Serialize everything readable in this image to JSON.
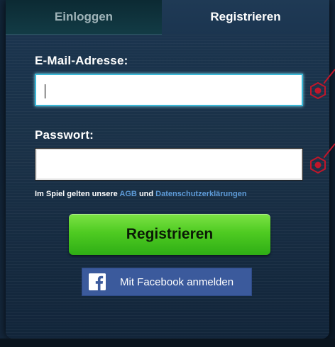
{
  "tabs": {
    "login_label": "Einloggen",
    "register_label": "Registrieren",
    "active": "register"
  },
  "form": {
    "email_label": "E-Mail-Adresse:",
    "email_value": "",
    "password_label": "Passwort:",
    "password_value": "",
    "legal_prefix": "Im Spiel gelten unsere",
    "legal_link_agb": "AGB",
    "legal_and": "und",
    "legal_link_privacy": "Datenschutzerklärungen",
    "submit_label": "Registrieren",
    "facebook_label": "Mit Facebook anmelden"
  },
  "icons": {
    "field_marker": "red-hexagon-icon",
    "facebook": "facebook-icon"
  },
  "colors": {
    "accent_green": "#4fcb22",
    "facebook_blue": "#3b5a9c",
    "link_blue": "#5e9bd8",
    "marker_red": "#c0162a",
    "focus_cyan": "#3ab7d6"
  }
}
